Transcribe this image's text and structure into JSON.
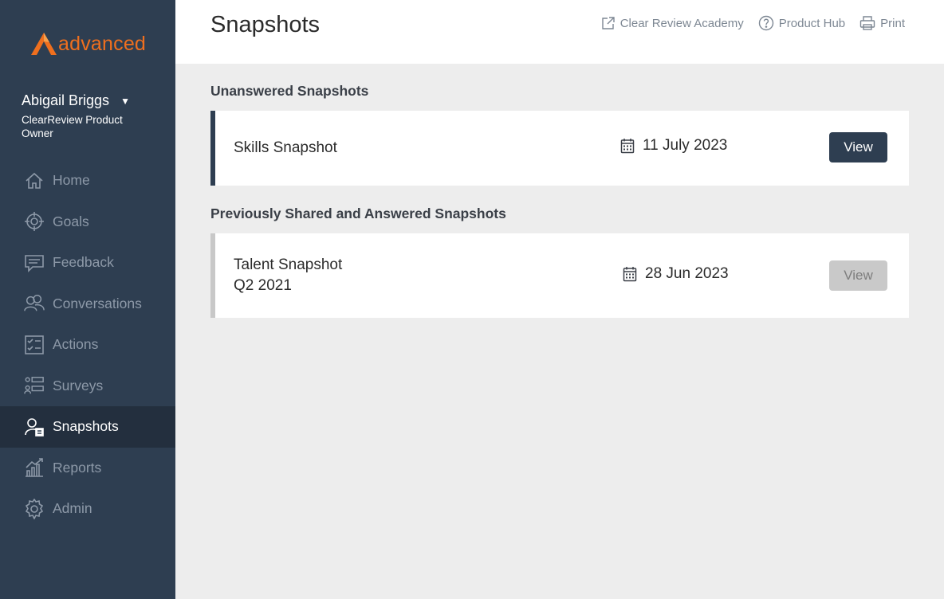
{
  "brand": {
    "name": "advanced",
    "logo_color": "#ef6f1e"
  },
  "user": {
    "name": "Abigail Briggs",
    "role": "ClearReview Product Owner",
    "menu_icon": "caret-down-icon"
  },
  "nav": {
    "items": [
      {
        "label": "Home",
        "icon": "home-icon",
        "active": false
      },
      {
        "label": "Goals",
        "icon": "target-icon",
        "active": false
      },
      {
        "label": "Feedback",
        "icon": "feedback-icon",
        "active": false
      },
      {
        "label": "Conversations",
        "icon": "conversations-icon",
        "active": false
      },
      {
        "label": "Actions",
        "icon": "checklist-icon",
        "active": false
      },
      {
        "label": "Surveys",
        "icon": "survey-icon",
        "active": false
      },
      {
        "label": "Snapshots",
        "icon": "snapshot-icon",
        "active": true
      },
      {
        "label": "Reports",
        "icon": "chart-icon",
        "active": false
      },
      {
        "label": "Admin",
        "icon": "gear-icon",
        "active": false
      }
    ]
  },
  "header": {
    "title": "Snapshots",
    "links": [
      {
        "label": "Clear Review Academy",
        "icon": "external-link-icon"
      },
      {
        "label": "Product Hub",
        "icon": "help-icon"
      },
      {
        "label": "Print",
        "icon": "print-icon"
      }
    ]
  },
  "sections": {
    "unanswered": {
      "heading": "Unanswered Snapshots",
      "items": [
        {
          "title": "Skills Snapshot",
          "subtitle": "",
          "date": "11 July 2023",
          "button": "View"
        }
      ]
    },
    "answered": {
      "heading": "Previously Shared and Answered Snapshots",
      "items": [
        {
          "title": "Talent Snapshot",
          "subtitle": "Q2 2021",
          "date": "28 Jun 2023",
          "button": "View"
        }
      ]
    }
  },
  "colors": {
    "sidebar_bg": "#2e3e51",
    "sidebar_active_bg": "#232f3e",
    "content_bg": "#ededed",
    "primary_button": "#2e3e51",
    "disabled_button": "#c9c9c9"
  }
}
